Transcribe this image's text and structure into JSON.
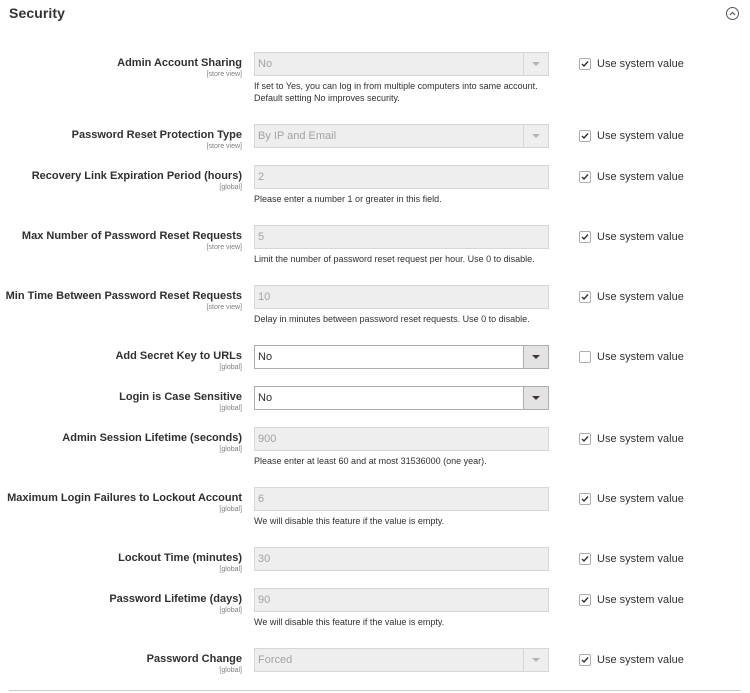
{
  "section": {
    "title": "Security",
    "collapse_icon": "chevron-up-circle-icon"
  },
  "use_system_label": "Use system value",
  "fields": [
    {
      "label": "Admin Account Sharing",
      "scope": "[store view]",
      "type": "select",
      "value": "No",
      "disabled": true,
      "note": "If set to Yes, you can log in from multiple computers into same account. Default setting No improves security.",
      "use_system": true
    },
    {
      "label": "Password Reset Protection Type",
      "scope": "[store view]",
      "type": "select",
      "value": "By IP and Email",
      "disabled": true,
      "note": "",
      "use_system": true
    },
    {
      "label": "Recovery Link Expiration Period (hours)",
      "scope": "[global]",
      "type": "text",
      "value": "2",
      "disabled": true,
      "note": "Please enter a number 1 or greater in this field.",
      "use_system": true
    },
    {
      "label": "Max Number of Password Reset Requests",
      "scope": "[store view]",
      "type": "text",
      "value": "5",
      "disabled": true,
      "note": "Limit the number of password reset request per hour. Use 0 to disable.",
      "use_system": true
    },
    {
      "label": "Min Time Between Password Reset Requests",
      "scope": "[store view]",
      "type": "text",
      "value": "10",
      "disabled": true,
      "note": "Delay in minutes between password reset requests. Use 0 to disable.",
      "use_system": true
    },
    {
      "label": "Add Secret Key to URLs",
      "scope": "[global]",
      "type": "select",
      "value": "No",
      "disabled": false,
      "note": "",
      "use_system": false
    },
    {
      "label": "Login is Case Sensitive",
      "scope": "[global]",
      "type": "select",
      "value": "No",
      "disabled": false,
      "note": "",
      "use_system": null
    },
    {
      "label": "Admin Session Lifetime (seconds)",
      "scope": "[global]",
      "type": "text",
      "value": "900",
      "disabled": true,
      "note": "Please enter at least 60 and at most 31536000 (one year).",
      "use_system": true
    },
    {
      "label": "Maximum Login Failures to Lockout Account",
      "scope": "[global]",
      "type": "text",
      "value": "6",
      "disabled": true,
      "note": "We will disable this feature if the value is empty.",
      "use_system": true
    },
    {
      "label": "Lockout Time (minutes)",
      "scope": "[global]",
      "type": "text",
      "value": "30",
      "disabled": true,
      "note": "",
      "use_system": true
    },
    {
      "label": "Password Lifetime (days)",
      "scope": "[global]",
      "type": "text",
      "value": "90",
      "disabled": true,
      "note": "We will disable this feature if the value is empty.",
      "use_system": true
    },
    {
      "label": "Password Change",
      "scope": "[global]",
      "type": "select",
      "value": "Forced",
      "disabled": true,
      "note": "",
      "use_system": true
    }
  ]
}
